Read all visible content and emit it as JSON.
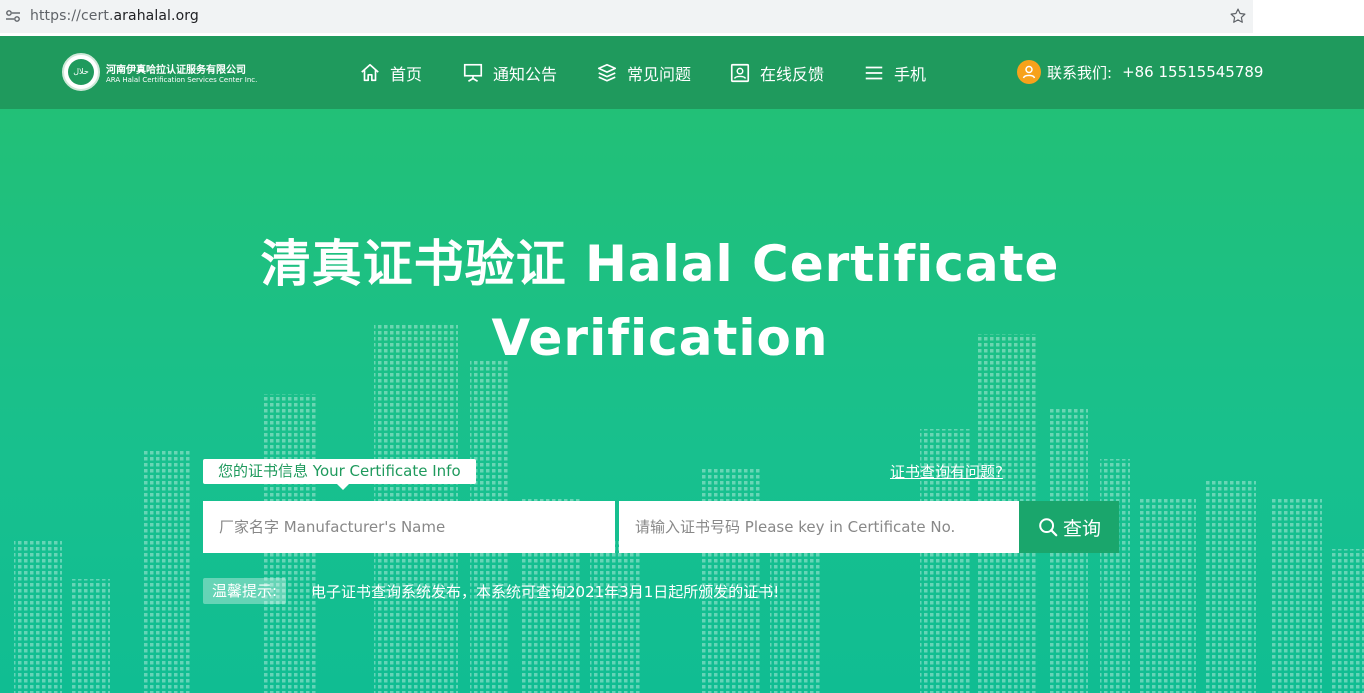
{
  "browser": {
    "url_scheme": "https://cert.",
    "url_host": "arahalal.org",
    "icons": {
      "site_info": "tune-icon",
      "bookmark": "star-icon"
    }
  },
  "header": {
    "logo": {
      "badge_text": "حلال",
      "name_cn": "河南伊真哈拉认证服务有限公司",
      "name_en": "ARA Halal Certification Services Center Inc."
    },
    "nav": [
      {
        "label": "首页",
        "icon": "home-icon"
      },
      {
        "label": "通知公告",
        "icon": "presentation-icon"
      },
      {
        "label": "常见问题",
        "icon": "layers-icon"
      },
      {
        "label": "在线反馈",
        "icon": "feedback-icon"
      },
      {
        "label": "手机",
        "icon": "menu-icon"
      }
    ],
    "contact": {
      "label": "联系我们:",
      "phone": "+86 15515545789",
      "icon": "user-icon",
      "icon_color": "#f7a21b"
    }
  },
  "hero": {
    "title_line1": "清真证书验证 Halal Certificate",
    "title_line2": "Verification",
    "info_tag": "您的证书信息 Your Certificate Info",
    "help_link": "证书查询有问题?",
    "manufacturer_placeholder": "厂家名字 Manufacturer's Name",
    "manufacturer_value": "",
    "cert_placeholder": "请输入证书号码 Please key in Certificate No.",
    "cert_value": "",
    "search_label": "查询",
    "tip_label": "温馨提示:",
    "tip_text": "电子证书查询系统发布，本系统可查询2021年3月1日起所颁发的证书!"
  },
  "colors": {
    "header_bg": "#1f9a5d",
    "hero_bg": "#21c07a",
    "search_btn": "#1aa66c"
  }
}
